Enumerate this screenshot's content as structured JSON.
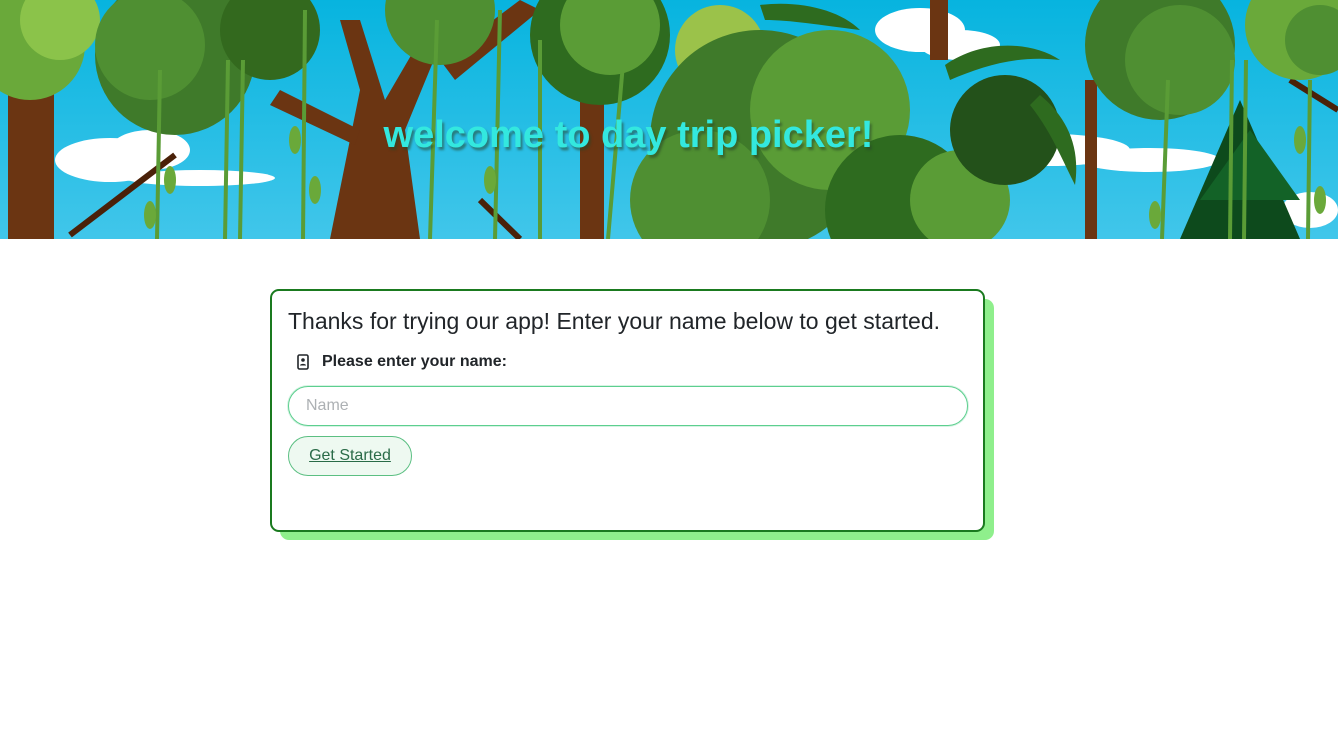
{
  "header": {
    "title": "welcome to day trip picker!"
  },
  "card": {
    "intro": "Thanks for trying our app! Enter your name below to get started.",
    "name_label": "Please enter your name:",
    "name_icon": "contact-card-icon",
    "name_input": {
      "value": "",
      "placeholder": "Name"
    },
    "start_button": "Get Started"
  },
  "colors": {
    "title": "#33e8df",
    "card_border": "#1a7a1f",
    "card_shadow": "#8fef8c",
    "input_border": "#5dcf8f",
    "button_bg": "#eef9f1",
    "button_text": "#2a6b48"
  }
}
